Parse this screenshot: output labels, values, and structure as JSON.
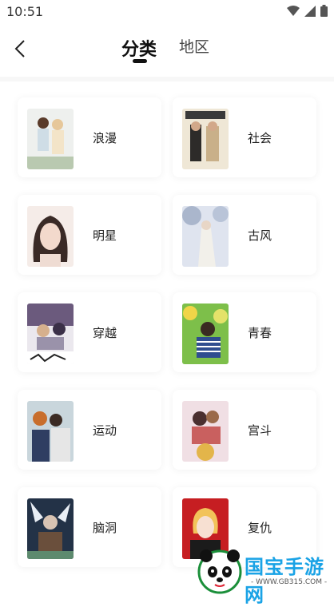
{
  "status": {
    "time": "10:51"
  },
  "header": {
    "tabs": [
      {
        "label": "分类"
      },
      {
        "label": "地区"
      }
    ]
  },
  "categories": [
    {
      "label": "浪漫"
    },
    {
      "label": "社会"
    },
    {
      "label": "明星"
    },
    {
      "label": "古风"
    },
    {
      "label": "穿越"
    },
    {
      "label": "青春"
    },
    {
      "label": "运动"
    },
    {
      "label": "宫斗"
    },
    {
      "label": "脑洞"
    },
    {
      "label": "复仇"
    }
  ],
  "watermark": {
    "brand": "国宝手游网",
    "url": "- WWW.GB315.COM -"
  },
  "colors": {
    "accent": "#111111",
    "watermark": "#1aa3e6"
  }
}
